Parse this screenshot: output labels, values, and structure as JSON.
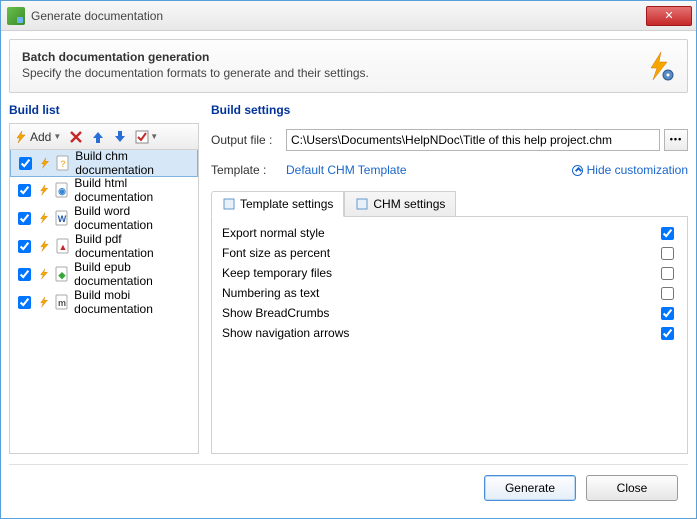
{
  "window": {
    "title": "Generate documentation"
  },
  "header": {
    "title": "Batch documentation generation",
    "subtitle": "Specify the documentation formats to generate and their settings."
  },
  "buildList": {
    "title": "Build list",
    "addLabel": "Add",
    "items": [
      {
        "label": "Build chm documentation",
        "checked": true,
        "selected": true,
        "icon": "chm"
      },
      {
        "label": "Build html documentation",
        "checked": true,
        "selected": false,
        "icon": "html"
      },
      {
        "label": "Build word documentation",
        "checked": true,
        "selected": false,
        "icon": "word"
      },
      {
        "label": "Build pdf documentation",
        "checked": true,
        "selected": false,
        "icon": "pdf"
      },
      {
        "label": "Build epub documentation",
        "checked": true,
        "selected": false,
        "icon": "epub"
      },
      {
        "label": "Build mobi documentation",
        "checked": true,
        "selected": false,
        "icon": "mobi"
      }
    ]
  },
  "buildSettings": {
    "title": "Build settings",
    "outputLabel": "Output file :",
    "outputValue": "C:\\Users\\Documents\\HelpNDoc\\Title of this help project.chm",
    "templateLabel": "Template :",
    "templateValue": "Default CHM Template",
    "hideCustomization": "Hide customization",
    "tabs": [
      "Template settings",
      "CHM settings"
    ],
    "activeTab": 0,
    "settings": [
      {
        "label": "Export normal style",
        "checked": true
      },
      {
        "label": "Font size as percent",
        "checked": false
      },
      {
        "label": "Keep temporary files",
        "checked": false
      },
      {
        "label": "Numbering as text",
        "checked": false
      },
      {
        "label": "Show BreadCrumbs",
        "checked": true
      },
      {
        "label": "Show navigation arrows",
        "checked": true
      }
    ]
  },
  "footer": {
    "generate": "Generate",
    "close": "Close"
  }
}
